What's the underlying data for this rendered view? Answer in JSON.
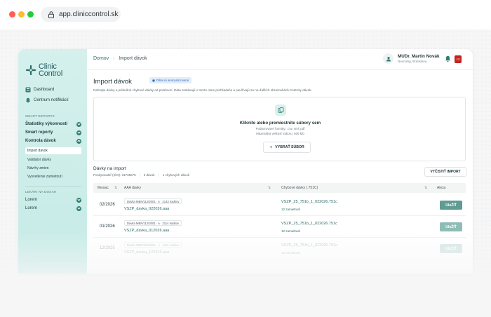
{
  "browser": {
    "url": "app.cliniccontrol.sk"
  },
  "logo": {
    "line1": "Clinic",
    "line2": "Control"
  },
  "sidebar": {
    "top_items": [
      {
        "label": "Dashboard",
        "icon": "dashboard-icon"
      },
      {
        "label": "Centrum notifikácií",
        "icon": "bell-icon"
      }
    ],
    "section_smart": "SMART REPORTS",
    "groups": [
      {
        "label": "Štatistiky výkonnosti"
      },
      {
        "label": "Smart reporty"
      },
      {
        "label": "Kontrola dávok"
      }
    ],
    "sub_items": [
      {
        "label": "Import dávok",
        "active": true
      },
      {
        "label": "Validátor dávky"
      },
      {
        "label": "Návrhy zmien"
      },
      {
        "label": "Vysvetlenie zamietnutí"
      }
    ],
    "section_lekari": "LEKÁRI NA DOSAH",
    "lorem_items": [
      {
        "label": "Lorem"
      },
      {
        "label": "Lorem"
      }
    ]
  },
  "topbar": {
    "crumb_home": "Domov",
    "crumb_current": "Import dávok",
    "user_name": "MUDr. Martin Novák",
    "user_role": "Neurológ, Bratislava",
    "notif_count": "12"
  },
  "main": {
    "title": "Import dávok",
    "badge": "Dáta sú anonymizované",
    "description": "Nahrajte dávky a príslušné chybové dávky od poisťovní. Dáta zostávajú v tomto okne prehliadača a používajú sa na ďalších obrazovkách Kontroly dávok."
  },
  "dropzone": {
    "title": "Kliknite alebo premiestnite súbory sem",
    "line1": "Podporované formáty: .csv, xml, pdf",
    "line2": "Maximálna veľkosť súboru: 500 Mb",
    "button": "VYBRAŤ SÚBOR"
  },
  "batches": {
    "title": "Dávky na import",
    "stat_provider": "Poskytovateľ (IČO): 31735675",
    "stat_batches": "3 dávok",
    "stat_errors": "1 chybových dávok",
    "clear_button": "VYČISTIŤ IMPORT",
    "columns": {
      "month": "Mesiac",
      "aaa": "AAA dávky",
      "err": "Chybové dávky (.751C)",
      "action": "Akcia"
    },
    "rows": [
      {
        "month": "02/2026",
        "tag": "Dávka MBN/112/2001 · A · 2143 riadkov",
        "aaa_file": "VSZP_davka_022026.aaa",
        "err_file": "VSZP_25_751b_1_022026.751c",
        "err_count": "12 zamietnutí",
        "button": "UloŽIŤ"
      },
      {
        "month": "01/2026",
        "tag": "Dávka MBN/112/2001 · A · 2114 riadkov",
        "aaa_file": "VSZP_davka_012026.aaa",
        "err_file": "VSZP_25_751b_1_022026.751c",
        "err_count": "12 zamietnutí",
        "button": "UloŽIŤ"
      },
      {
        "month": "12/2025",
        "tag": "Dávka MBN/112/2001 · A · 1461 riadkov",
        "aaa_file": "VSZP_davka_122025.aaa",
        "err_file": "VSZP_25_751b_1_022026.751c",
        "err_count": "12 zamietnutí",
        "button": "UloŽIŤ"
      }
    ]
  },
  "colors": {
    "accent": "#2f7e75",
    "sidebar": "#cdeee9",
    "notif": "#c4231c",
    "save_btn": "#5f9c93"
  }
}
